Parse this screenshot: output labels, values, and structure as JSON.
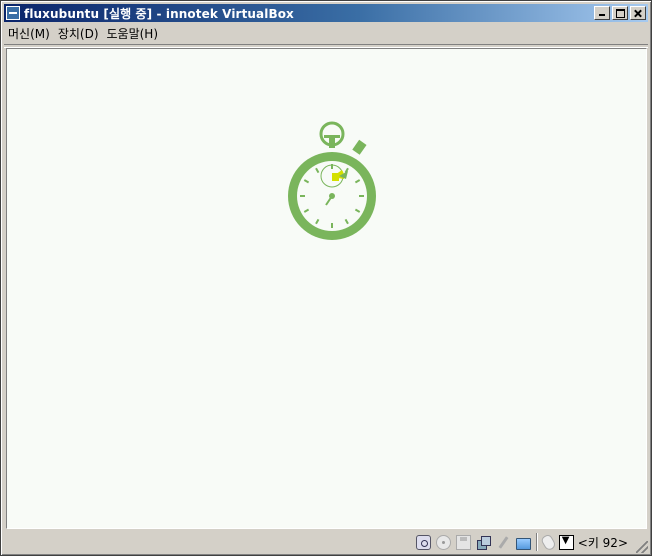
{
  "window": {
    "title": "fluxubuntu [실행 중] - innotek VirtualBox"
  },
  "menubar": {
    "items": [
      {
        "label": "머신(M)",
        "name": "menu-machine"
      },
      {
        "label": "장치(D)",
        "name": "menu-devices"
      },
      {
        "label": "도움말(H)",
        "name": "menu-help"
      }
    ]
  },
  "screen": {
    "icon": "stopwatch-icon",
    "accent_color": "#7ab55c",
    "highlight_color": "#d4e000"
  },
  "statusbar": {
    "icons": [
      "hard-disk-icon",
      "cd-icon",
      "floppy-icon",
      "network-icon",
      "usb-icon",
      "shared-folder-icon",
      "mouse-integration-icon",
      "host-key-capture-icon"
    ],
    "host_key": "<키 92>"
  }
}
